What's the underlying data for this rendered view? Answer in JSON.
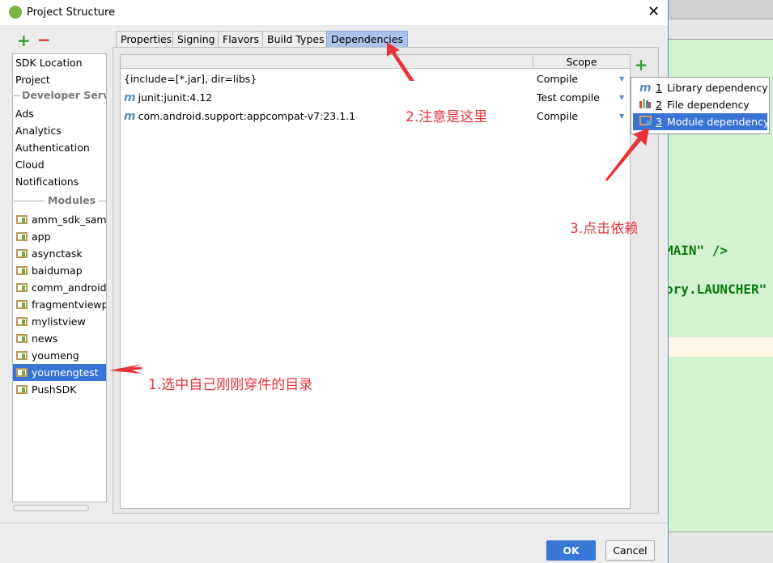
{
  "window": {
    "title": "Project Structure",
    "close_icon": "close-icon"
  },
  "editor_background": {
    "code_lines": [
      "MAIN\" />",
      "ory.LAUNCHER\""
    ]
  },
  "sidebar": {
    "add_icon": "plus-icon",
    "remove_icon": "minus-icon",
    "items": [
      "SDK Location",
      "Project"
    ],
    "developer_services_header": "Developer Services",
    "developer_services": [
      "Ads",
      "Analytics",
      "Authentication",
      "Cloud",
      "Notifications"
    ],
    "modules_header": "Modules",
    "modules": [
      {
        "label": "amm_sdk_samp",
        "selected": false
      },
      {
        "label": "app",
        "selected": false
      },
      {
        "label": "asynctask",
        "selected": false
      },
      {
        "label": "baidumap",
        "selected": false
      },
      {
        "label": "comm_android",
        "selected": false
      },
      {
        "label": "fragmentviewpa",
        "selected": false
      },
      {
        "label": "mylistview",
        "selected": false
      },
      {
        "label": "news",
        "selected": false
      },
      {
        "label": "youmeng",
        "selected": false
      },
      {
        "label": "youmengtest",
        "selected": true
      },
      {
        "label": "PushSDK",
        "selected": false
      }
    ]
  },
  "tabs": [
    {
      "label": "Properties",
      "active": false
    },
    {
      "label": "Signing",
      "active": false
    },
    {
      "label": "Flavors",
      "active": false
    },
    {
      "label": "Build Types",
      "active": false
    },
    {
      "label": "Dependencies",
      "active": true
    }
  ],
  "dependencies": {
    "columns": [
      "",
      "Scope"
    ],
    "rows": [
      {
        "name": "{include=[*.jar], dir=libs}",
        "icon": "",
        "scope": "Compile"
      },
      {
        "name": "junit:junit:4.12",
        "icon": "m",
        "scope": "Test compile"
      },
      {
        "name": "com.android.support:appcompat-v7:23.1.1",
        "icon": "m",
        "scope": "Compile"
      }
    ]
  },
  "add_menu": {
    "items": [
      {
        "key": "1",
        "label": "Library dependency",
        "icon": "m",
        "selected": false
      },
      {
        "key": "2",
        "label": "File dependency",
        "icon": "bars-icon",
        "selected": false
      },
      {
        "key": "3",
        "label": "Module dependency",
        "icon": "folder-icon",
        "selected": true
      }
    ]
  },
  "buttons": {
    "ok": "OK",
    "cancel": "Cancel"
  },
  "annotations": {
    "step1": "1.选中自己刚刚穿件的目录",
    "step2": "2.注意是这里",
    "step3": "3.点击依赖",
    "color": "#e8333a"
  }
}
